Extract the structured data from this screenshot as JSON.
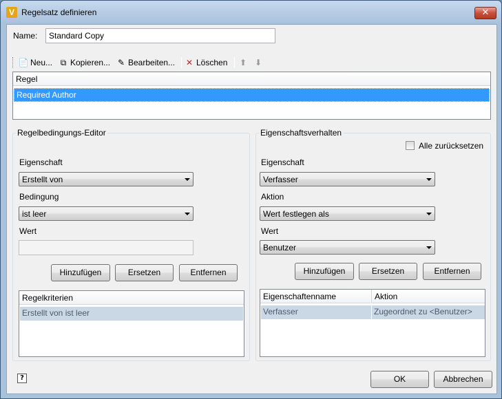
{
  "window": {
    "title": "Regelsatz definieren",
    "app_icon": "V",
    "close_glyph": "✕"
  },
  "name_field": {
    "label": "Name:",
    "value": "Standard Copy"
  },
  "toolbar": {
    "new_label": "Neu...",
    "copy_label": "Kopieren...",
    "edit_label": "Bearbeiten...",
    "delete_label": "Löschen"
  },
  "rules_list": {
    "header": "Regel",
    "items": [
      "Required Author"
    ]
  },
  "condition_editor": {
    "title": "Regelbedingungs-Editor",
    "property_label": "Eigenschaft",
    "property_value": "Erstellt von",
    "condition_label": "Bedingung",
    "condition_value": "ist leer",
    "value_label": "Wert",
    "value_value": "",
    "add_label": "Hinzufügen",
    "replace_label": "Ersetzen",
    "remove_label": "Entfernen",
    "criteria_header": "Regelkriterien",
    "criteria_items": [
      "Erstellt von ist leer"
    ]
  },
  "property_behavior": {
    "title": "Eigenschaftsverhalten",
    "reset_all_label": "Alle zurücksetzen",
    "reset_all_checked": false,
    "property_label": "Eigenschaft",
    "property_value": "Verfasser",
    "action_label": "Aktion",
    "action_value": "Wert festlegen als",
    "value_label": "Wert",
    "value_value": "Benutzer",
    "add_label": "Hinzufügen",
    "replace_label": "Ersetzen",
    "remove_label": "Entfernen",
    "table_headers": [
      "Eigenschaftenname",
      "Aktion"
    ],
    "table_rows": [
      {
        "name": "Verfasser",
        "action": "Zugeordnet zu <Benutzer>"
      }
    ]
  },
  "footer": {
    "help_glyph": "?",
    "ok_label": "OK",
    "cancel_label": "Abbrechen"
  },
  "colors": {
    "selection": "#3399ff",
    "titlebar": "#a8c1db",
    "close": "#c8503c",
    "app_icon": "#e8a317"
  }
}
